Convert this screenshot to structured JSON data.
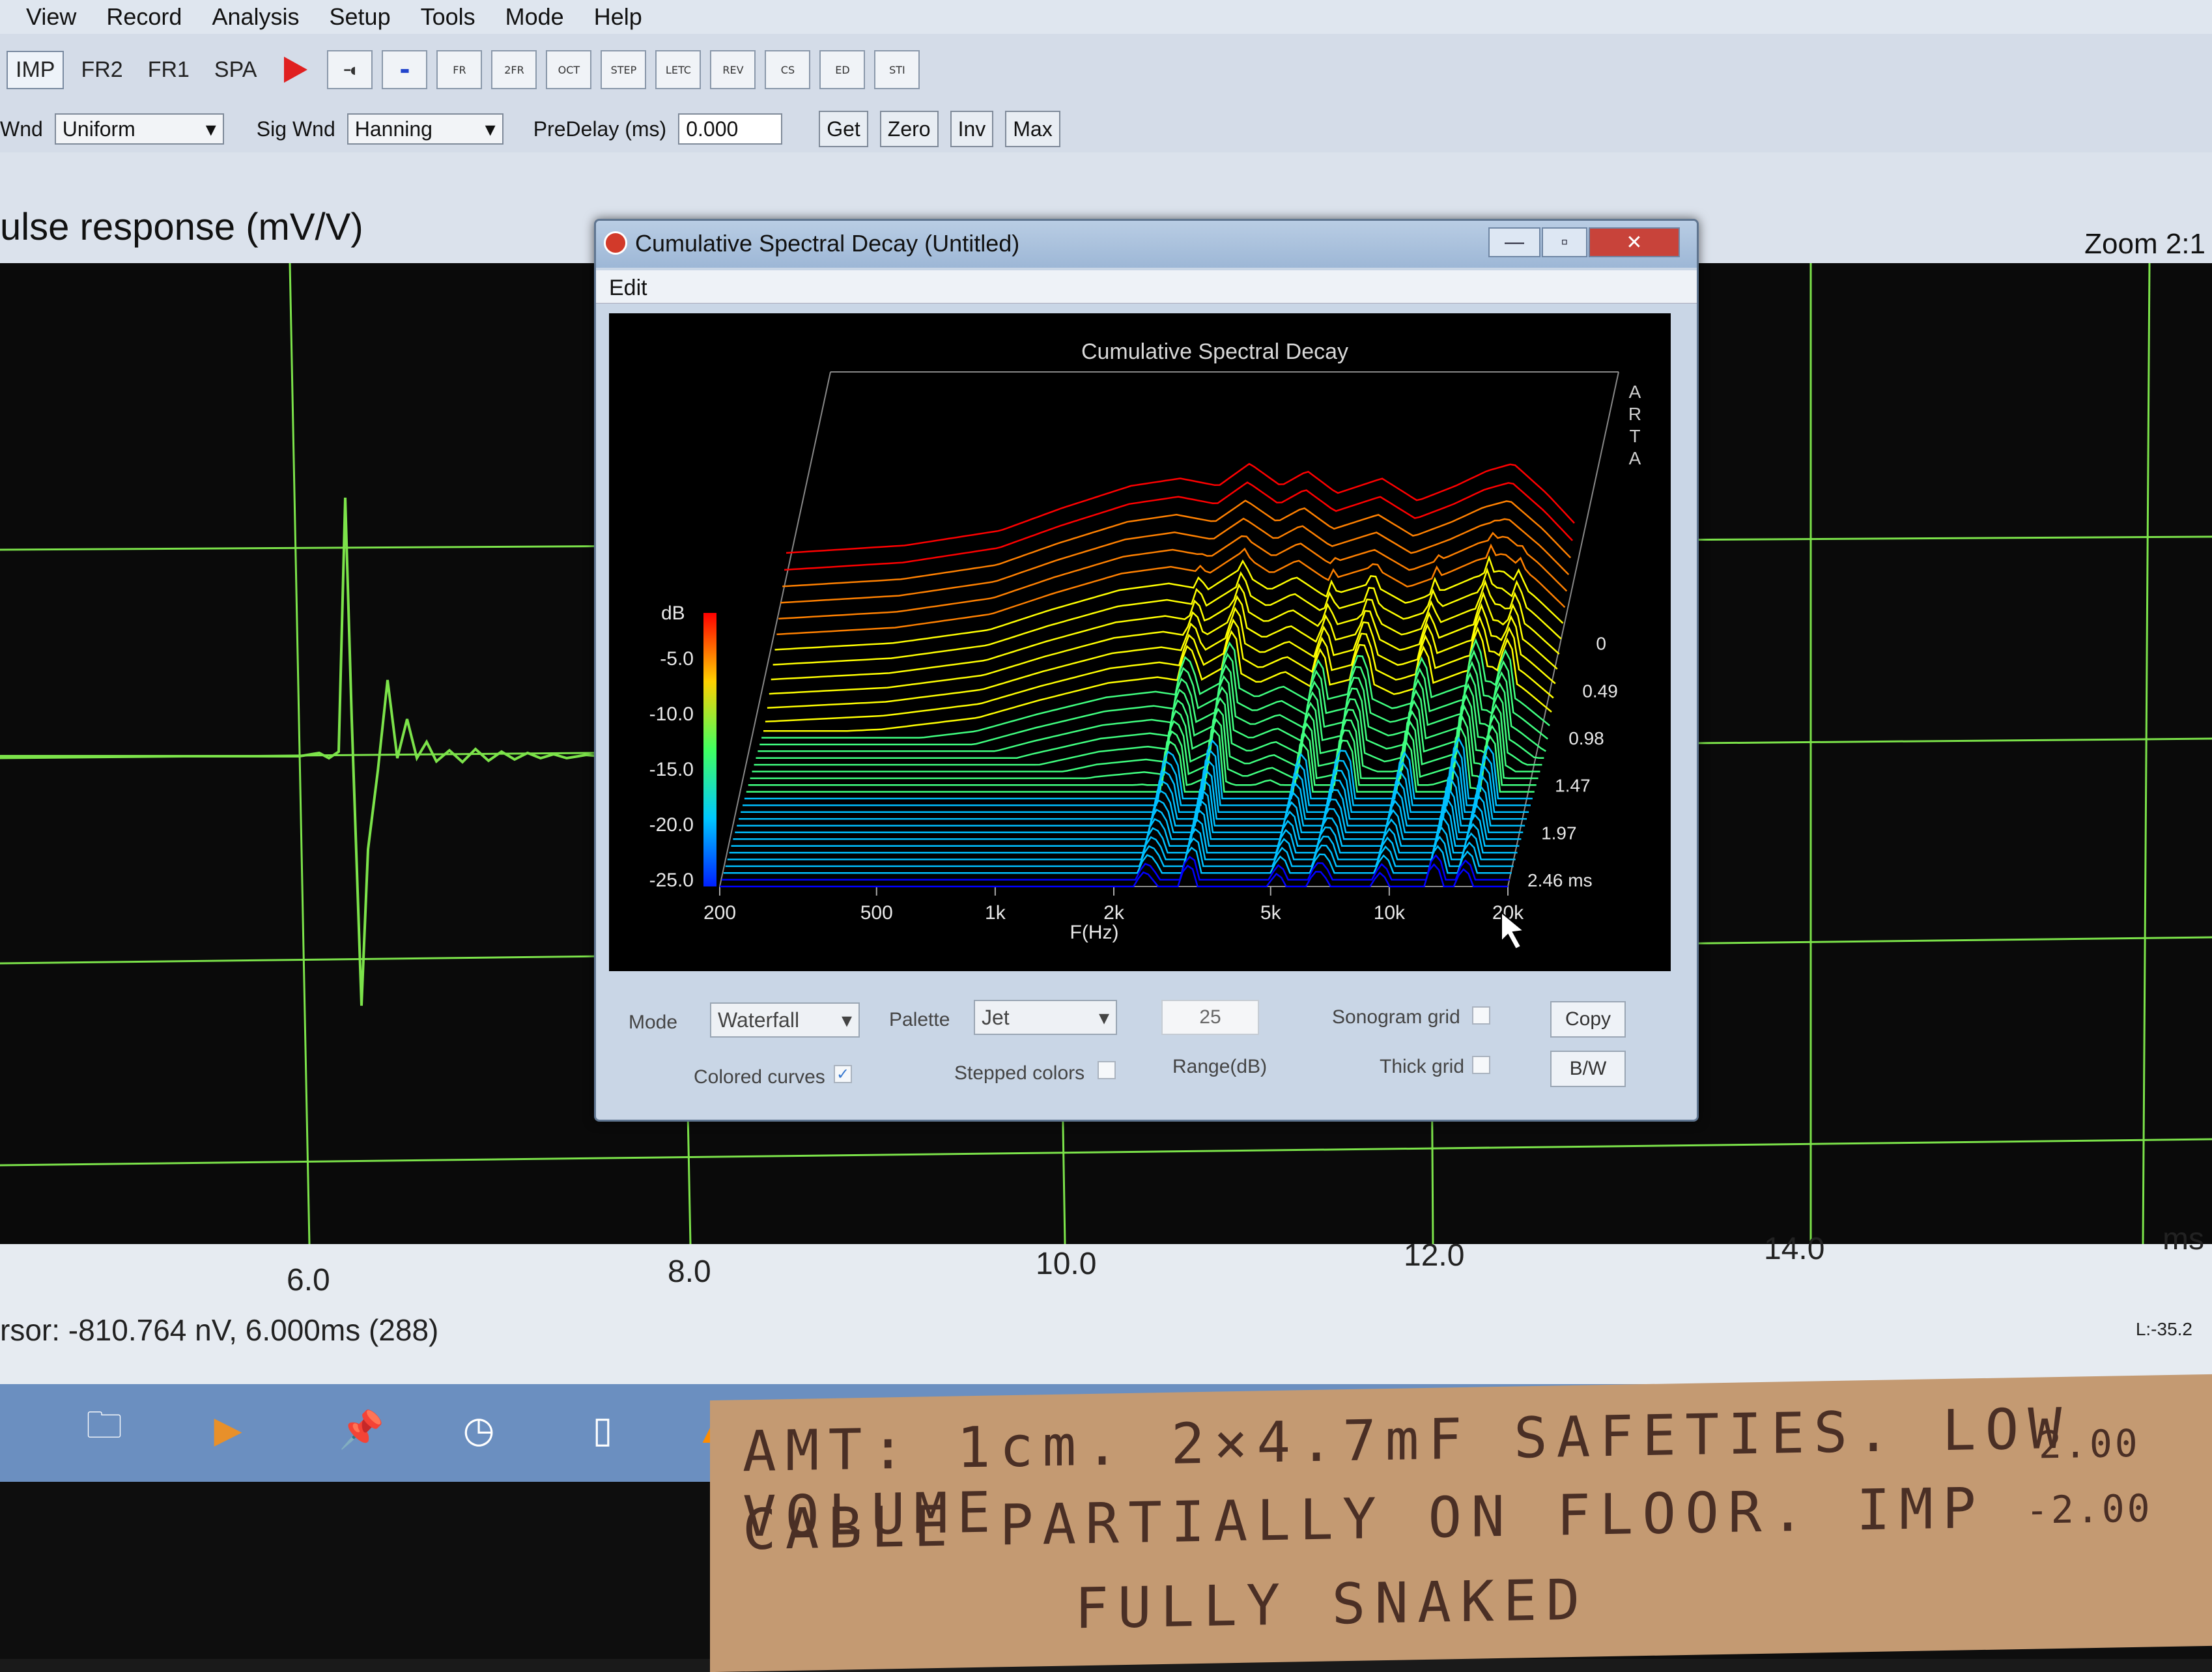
{
  "menu": [
    "View",
    "Record",
    "Analysis",
    "Setup",
    "Tools",
    "Mode",
    "Help"
  ],
  "toolbar": {
    "modes": [
      "IMP",
      "FR2",
      "FR1",
      "SPA"
    ],
    "active_mode": "IMP",
    "icon_buttons": [
      "FR",
      "2FR",
      "OCT",
      "STEP",
      "LETC",
      "REV",
      "CS",
      "ED",
      "STI"
    ]
  },
  "params": {
    "wnd_label": "Wnd",
    "wnd_value": "Uniform",
    "sig_wnd_label": "Sig Wnd",
    "sig_wnd_value": "Hanning",
    "predelay_label": "PreDelay (ms)",
    "predelay_value": "0.000",
    "buttons": [
      "Get",
      "Zero",
      "Inv",
      "Max"
    ]
  },
  "graph": {
    "title": "ulse response (mV/V)",
    "zoom": "Zoom 2:1",
    "x_ticks": [
      "6.0",
      "8.0",
      "10.0",
      "12.0",
      "14.0"
    ],
    "x_unit": "ms",
    "cursor": "rsor: -810.764 nV, 6.000ms (288)",
    "level": "L:-35.2"
  },
  "dialog": {
    "title": "Cumulative Spectral Decay  (Untitled)",
    "menu": "Edit",
    "minimize": "—",
    "maximize": "▫",
    "close": "✕",
    "controls": {
      "mode_label": "Mode",
      "mode_value": "Waterfall",
      "palette_label": "Palette",
      "palette_value": "Jet",
      "range_value": "25",
      "range_label": "Range(dB)",
      "sonogram_label": "Sonogram grid",
      "thick_label": "Thick grid",
      "colored_label": "Colored curves",
      "stepped_label": "Stepped colors",
      "copy": "Copy",
      "bw": "B/W"
    }
  },
  "chart_data": {
    "type": "area",
    "title": "Cumulative Spectral Decay",
    "xlabel": "F(Hz)",
    "ylabel": "dB",
    "zlabel": "ms",
    "x_ticks": [
      "200",
      "500",
      "1k",
      "2k",
      "5k",
      "10k",
      "20k"
    ],
    "y_ticks": [
      "-5.0",
      "-10.0",
      "-15.0",
      "-20.0",
      "-25.0"
    ],
    "z_ticks": [
      "0",
      "0.49",
      "0.98",
      "1.47",
      "1.97",
      "2.46 ms"
    ],
    "ylim": [
      -25,
      0
    ],
    "xlim": [
      200,
      20000
    ],
    "zlim": [
      0,
      2.46
    ],
    "x_scale": "log",
    "watermark": "ARTA",
    "colors": [
      "#0000ff",
      "#00c0ff",
      "#40ff80",
      "#ffff00",
      "#ff8000",
      "#ff0000"
    ]
  },
  "taskbar_icons": [
    "folder-icon",
    "media-player-icon",
    "pin-icon",
    "clock-icon",
    "document-icon",
    "vlc-icon"
  ],
  "note": {
    "line1": "AMT: 1cm. 2×4.7mF SAFETIES. LOW VOLUME",
    "line2": "CABLE PARTIALLY ON FLOOR. IMP",
    "line3": "FULLY SNAKED",
    "right1": "2.00",
    "right2": "-2.00"
  }
}
